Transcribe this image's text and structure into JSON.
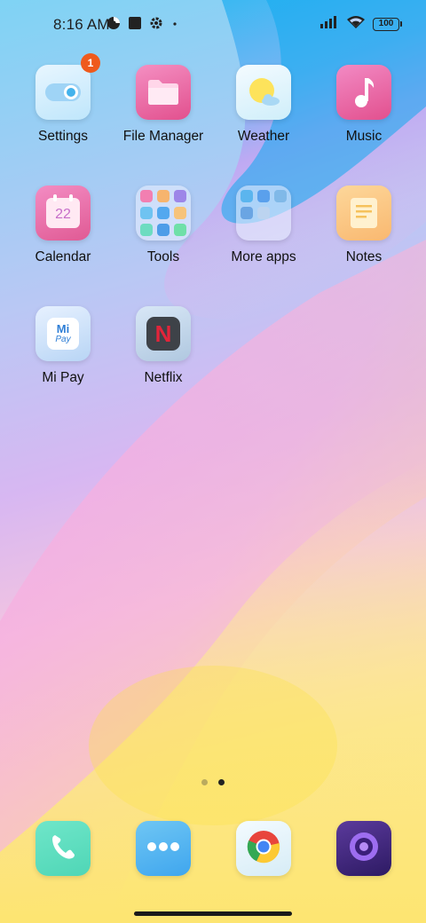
{
  "status_bar": {
    "time": "8:16 AM",
    "battery": "100",
    "icons_left": [
      "data-saver-icon",
      "square-notification-icon",
      "gear-icon",
      "dot-icon"
    ],
    "icons_right": [
      "signal-bars-icon",
      "wifi-icon",
      "battery-icon"
    ]
  },
  "apps": [
    {
      "label": "Settings",
      "icon": "toggle-icon",
      "badge": "1"
    },
    {
      "label": "File Manager",
      "icon": "folder-icon"
    },
    {
      "label": "Weather",
      "icon": "sun-cloud-icon"
    },
    {
      "label": "Music",
      "icon": "music-note-icon"
    },
    {
      "label": "Calendar",
      "icon": "calendar-icon",
      "date": "22"
    },
    {
      "label": "Tools",
      "icon": "folder-grid-icon"
    },
    {
      "label": "More apps",
      "icon": "folder-grid-icon"
    },
    {
      "label": "Notes",
      "icon": "note-icon"
    },
    {
      "label": "Mi Pay",
      "icon": "mi-pay-icon",
      "mark_top": "Mi",
      "mark_bottom": "Pay"
    },
    {
      "label": "Netflix",
      "icon": "netflix-icon",
      "mark": "N"
    }
  ],
  "pager": {
    "pages": 2,
    "active": 2
  },
  "dock": [
    {
      "name": "phone",
      "icon": "phone-icon"
    },
    {
      "name": "messaging",
      "icon": "chat-dots-icon"
    },
    {
      "name": "chrome",
      "icon": "chrome-icon"
    },
    {
      "name": "camera",
      "icon": "camera-lens-icon"
    }
  ],
  "colors": {
    "badge": "#ef5a1c",
    "status_text": "#1e1e1e"
  }
}
